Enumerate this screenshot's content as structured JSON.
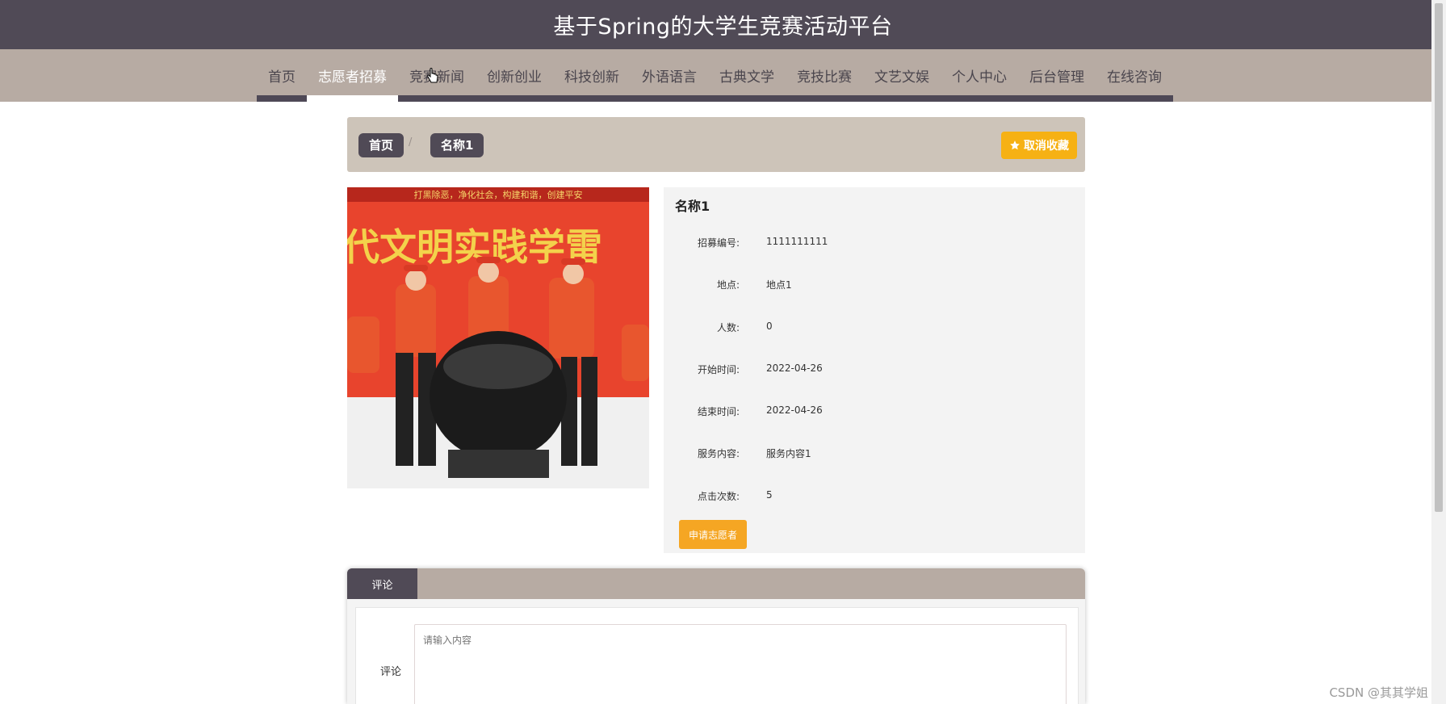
{
  "header": {
    "title": "基于Spring的大学生竞赛活动平台"
  },
  "nav": {
    "items": [
      {
        "label": "首页"
      },
      {
        "label": "志愿者招募"
      },
      {
        "label": "竞赛新闻"
      },
      {
        "label": "创新创业"
      },
      {
        "label": "科技创新"
      },
      {
        "label": "外语语言"
      },
      {
        "label": "古典文学"
      },
      {
        "label": "竞技比赛"
      },
      {
        "label": "文艺文娱"
      },
      {
        "label": "个人中心"
      },
      {
        "label": "后台管理"
      },
      {
        "label": "在线咨询"
      }
    ],
    "active": "志愿者招募"
  },
  "breadcrumb": {
    "home": "首页",
    "separator": "/",
    "current": "名称1"
  },
  "favorite_button": {
    "label": "取消收藏"
  },
  "detail": {
    "name": "名称1",
    "fields": [
      {
        "label": "招募编号:",
        "value": "1111111111"
      },
      {
        "label": "地点:",
        "value": "地点1"
      },
      {
        "label": "人数:",
        "value": "0"
      },
      {
        "label": "开始时间:",
        "value": "2022-04-26"
      },
      {
        "label": "结束时间:",
        "value": "2022-04-26"
      },
      {
        "label": "服务内容:",
        "value": "服务内容1"
      },
      {
        "label": "点击次数:",
        "value": "5"
      }
    ],
    "apply_label": "申请志愿者"
  },
  "photo": {
    "banner_top": "打黑除恶，净化社会，构建和谐，创建平安",
    "banner_main": "代文明实践学雷"
  },
  "comments": {
    "tab": "评论",
    "label": "评论",
    "placeholder": "请输入内容"
  },
  "watermark": "CSDN @其其学姐",
  "colors": {
    "header": "#504a56",
    "nav": "#b7aba3",
    "accent": "#f6b114"
  }
}
